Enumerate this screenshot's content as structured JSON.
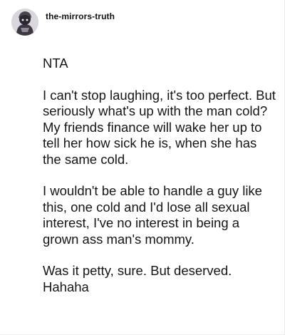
{
  "post": {
    "author": "the-mirrors-truth",
    "avatar_icon": "avatar-image",
    "paragraphs": [
      "NTA",
      "I can't stop laughing, it's too perfect. But seriously what's up with the man cold? My friends finance will wake her up to tell her how sick he is, when she has the same cold.",
      "I wouldn't be able to handle a guy like this, one cold and I'd lose all sexual interest, I've no interest in being a grown ass man's mommy.",
      "Was it petty, sure. But deserved. Hahaha"
    ]
  }
}
